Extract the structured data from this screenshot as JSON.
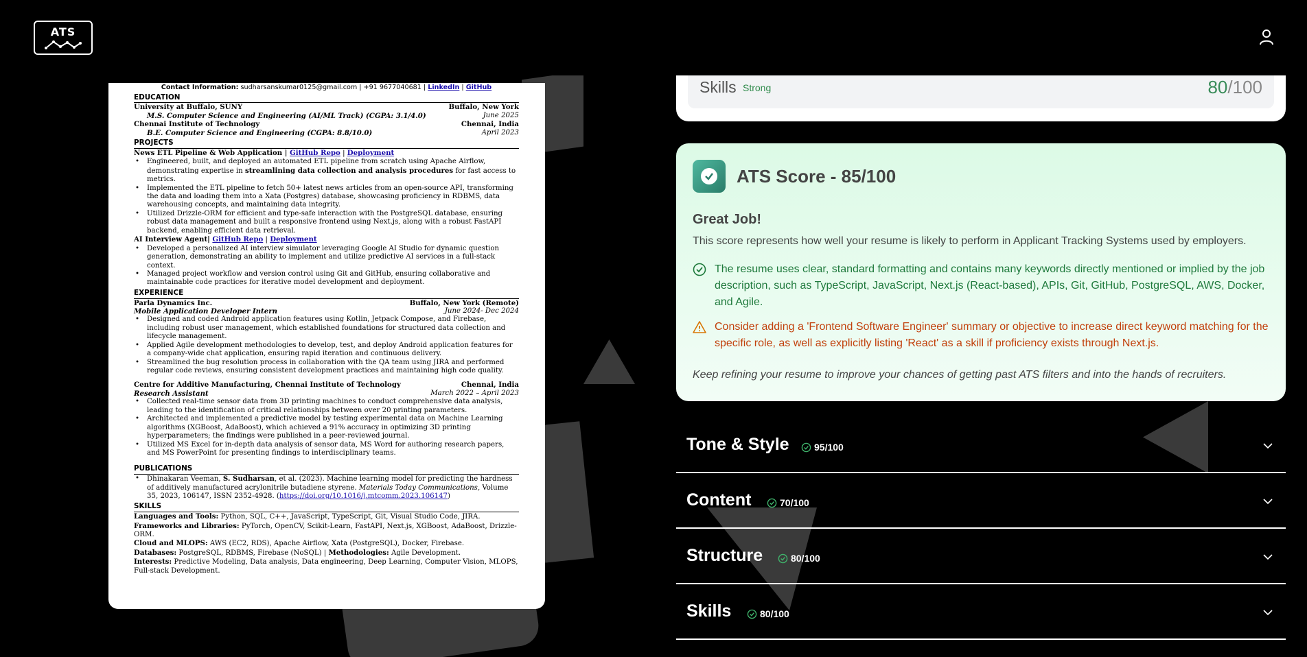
{
  "header": {
    "logo_text": "ATS",
    "logo_icon": "chart-line-icon",
    "user_icon": "user-icon"
  },
  "resume": {
    "contact_label": "Contact Information:",
    "contact_value": " sudharsanskumar0125@gmail.com | +91 9677040681 | ",
    "link_linkedin": "LinkedIn",
    "link_sep": " | ",
    "link_github": "GitHub",
    "education_heading": "EDUCATION",
    "edu1_school": "University at Buffalo, SUNY",
    "edu1_location": "Buffalo, New York",
    "edu1_degree": "M.S. Computer Science and Engineering (AI/ML Track) (CGPA: 3.1/4.0)",
    "edu1_date": "June 2025",
    "edu2_school": "Chennai Institute of Technology",
    "edu2_location": "Chennai, India",
    "edu2_degree": "B.E. Computer Science and Engineering (CGPA: 8.8/10.0)",
    "edu2_date": "April 2023",
    "projects_heading": "PROJECTS",
    "proj1_title": "News ETL Pipeline & Web Application | ",
    "proj1_repo": "GitHub Repo",
    "proj1_deploy": "Deployment",
    "proj1_b1_pre": "Engineered, built, and deployed an automated ETL pipeline from scratch using Apache Airflow, demonstrating expertise in ",
    "proj1_b1_bold": "streamlining data collection and analysis procedures",
    "proj1_b1_post": " for fast access to metrics.",
    "proj1_b2": "Implemented the ETL pipeline to fetch 50+ latest news articles from an open-source API, transforming the data and loading them into a Xata (Postgres) database, showcasing proficiency in RDBMS, data warehousing concepts, and maintaining data integrity.",
    "proj1_b3": "Utilized Drizzle-ORM for efficient and type-safe interaction with the PostgreSQL database, ensuring robust data management and built a responsive frontend using Next.js, along with a robust FastAPI backend, enabling efficient data retrieval.",
    "proj2_title": "AI Interview Agent| ",
    "proj2_repo": "GitHub Repo",
    "proj2_deploy": "Deployment",
    "proj2_b1": "Developed a personalized AI interview simulator leveraging Google AI Studio for dynamic question generation, demonstrating an ability to implement and utilize predictive AI services in a full-stack context.",
    "proj2_b2": "Managed project workflow and version control using Git and GitHub, ensuring collaborative and maintainable code practices for iterative model development and deployment.",
    "experience_heading": "EXPERIENCE",
    "exp1_company": "Parla Dynamics Inc.",
    "exp1_location": "Buffalo, New York (Remote)",
    "exp1_role": "Mobile Application Developer Intern",
    "exp1_date": "June 2024- Dec 2024",
    "exp1_b1": "Designed and coded Android application features using Kotlin, Jetpack Compose, and Firebase, including robust user management, which established foundations for structured data collection and lifecycle management.",
    "exp1_b2": "Applied Agile development methodologies to develop, test, and deploy Android application features for a company-wide chat application, ensuring rapid iteration and continuous delivery.",
    "exp1_b3": "Streamlined the bug resolution process in collaboration with the QA team using JIRA and performed regular code reviews, ensuring consistent development practices and maintaining high code quality.",
    "exp2_company": "Centre for Additive Manufacturing, Chennai Institute of Technology",
    "exp2_location": "Chennai, India",
    "exp2_role": "Research Assistant",
    "exp2_date": "March 2022 – April 2023",
    "exp2_b1": "Collected real-time sensor data from 3D printing machines to conduct comprehensive data analysis, leading to the identification of critical relationships between over 20 printing parameters.",
    "exp2_b2": "Architected and implemented a predictive model by testing experimental data on Machine Learning algorithms (XGBoost, AdaBoost), which achieved a 91% accuracy in optimizing 3D printing hyperparameters; the findings were published in a peer-reviewed journal.",
    "exp2_b3": "Utilized MS Excel for in-depth data analysis of sensor data, MS Word for authoring research papers, and MS PowerPoint for presenting findings to interdisciplinary teams.",
    "publications_heading": "PUBLICATIONS",
    "pub_pre": "Dhinakaran Veeman, ",
    "pub_bold": "S. Sudharsan",
    "pub_mid": ", et al. (2023). Machine learning model for predicting the hardness of additively manufactured acrylonitrile butadiene styrene. ",
    "pub_italic": "Materials Today Communications,",
    "pub_post": " Volume 35, 2023, 106147, ISSN 2352-4928. (",
    "pub_link": "https://doi.org/10.1016/j.mtcomm.2023.106147",
    "pub_close": ")",
    "skills_heading": "SKILLS",
    "sk_lang_label": "Languages and Tools:",
    "sk_lang": " Python, SQL, C++, JavaScript, TypeScript, Git, Visual Studio Code, JIRA.",
    "sk_fw_label": "Frameworks and Libraries:",
    "sk_fw": " PyTorch, OpenCV, Scikit-Learn, FastAPI, Next.js, XGBoost, AdaBoost, Drizzle-ORM.",
    "sk_cloud_label": "Cloud and MLOPS:",
    "sk_cloud": " AWS (EC2, RDS), Apache Airflow, Xata (PostgreSQL), Docker, Firebase.",
    "sk_db_label": "Databases:",
    "sk_db": " PostgreSQL, RDBMS, Firebase (NoSQL) | ",
    "sk_meth_label": "Methodologies:",
    "sk_meth": " Agile Development.",
    "sk_int_label": "Interests:",
    "sk_int": " Predictive Modeling, Data analysis, Data engineering, Deep Learning, Computer Vision, MLOPS, Full-stack Development."
  },
  "skills_top": {
    "title": "Skills",
    "badge": "Strong",
    "score": "80",
    "total": "/100"
  },
  "ats": {
    "title": "ATS Score - 85/100",
    "subtitle": "Great Job!",
    "description": "This score represents how well your resume is likely to perform in Applicant Tracking Systems used by employers.",
    "tip_good": "The resume uses clear, standard formatting and contains many keywords directly mentioned or implied by the job description, such as TypeScript, JavaScript, Next.js (React-based), APIs, Git, GitHub, PostgreSQL, AWS, Docker, and Agile.",
    "tip_warn": "Consider adding a 'Frontend Software Engineer' summary or objective to increase direct keyword matching for the specific role, as well as explicitly listing 'React' as a skill if proficiency exists through Next.js.",
    "footer": "Keep refining your resume to improve your chances of getting past ATS filters and into the hands of recruiters.",
    "colors": {
      "good": "#1f7a3c",
      "warn": "#c2410c",
      "card": "#dcfae6"
    }
  },
  "accordion": [
    {
      "title": "Tone & Style",
      "score": "95/100"
    },
    {
      "title": "Content",
      "score": "70/100"
    },
    {
      "title": "Structure",
      "score": "80/100"
    },
    {
      "title": "Skills",
      "score": "80/100"
    }
  ]
}
